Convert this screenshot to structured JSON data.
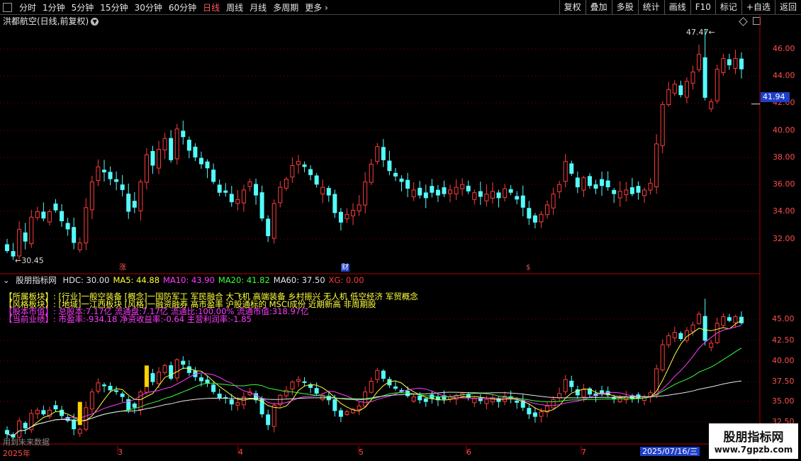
{
  "toolbar": {
    "timeframes": [
      "分时",
      "1分钟",
      "5分钟",
      "15分钟",
      "30分钟",
      "60分钟",
      "日线",
      "周线",
      "月线",
      "多周期",
      "更多"
    ],
    "active": "日线",
    "right_buttons": [
      "复权",
      "叠加",
      "多股",
      "统计",
      "画线",
      "F10",
      "标记",
      "+自选",
      "返回"
    ]
  },
  "stock": {
    "title": "洪都航空(日线,前复权)",
    "current_price": "41.94"
  },
  "price_axis": [
    "46.00",
    "44.00",
    "42.00",
    "40.00",
    "38.00",
    "36.00",
    "34.00",
    "32.00"
  ],
  "annotations": {
    "high": "47.47",
    "low": "30.45"
  },
  "events": [
    "涨",
    "财",
    "$"
  ],
  "indicator": {
    "name": "股朋指标网",
    "values": [
      {
        "label": "HDC: 30.00",
        "color": "#e6e6e6"
      },
      {
        "label": "MA5: 44.88",
        "color": "#ffff3c"
      },
      {
        "label": "MA10: 43.90",
        "color": "#ff3cff"
      },
      {
        "label": "MA20: 41.82",
        "color": "#3cff3c"
      },
      {
        "label": "MA60: 37.50",
        "color": "#e6e6e6"
      },
      {
        "label": "XG: 0.00",
        "color": "#ff3c3c"
      }
    ],
    "axis": [
      "45.00",
      "42.50",
      "40.00",
      "37.50",
      "35.00",
      "32.50"
    ]
  },
  "info_lines": [
    {
      "text": "【所属板块】: [行业]一般空装备 [概念]一国防军工 军民融合 大飞机 高端装备 乡村振兴 无人机 低空经济 军贸概念",
      "color": "#ffff3c"
    },
    {
      "text": "【风格板块】: [地域]一江西板块 [风格]一融资融券 高市盈率 沪股通标的 MSCI成份 近期新高 非周期股",
      "color": "#ffff3c"
    },
    {
      "text": "【股本市值】: 总股本:7.17亿 流通盘:7.17亿 流通比:100.00% 流通市值:318.97亿",
      "color": "#ff3cff"
    },
    {
      "text": "【当前业绩】: 市盈率:-934.18 净资收益率:-0.64 主营利润率:-1.85",
      "color": "#ff3cff"
    }
  ],
  "dates": [
    "2025年",
    "3",
    "4",
    "5",
    "6",
    "7"
  ],
  "date_tag": "2025/07/16/三",
  "footer": "用到未来数据",
  "watermark": {
    "name": "股朋指标网",
    "url": "www.7gpzb.com"
  },
  "colors": {
    "up": "#ff3c3c",
    "down": "#54fcfc",
    "background": "#000000",
    "grid": "#7a0000",
    "tag": "#1e40c8"
  },
  "chart_data": {
    "type": "candlestick",
    "title": "洪都航空(日线,前复权)",
    "ylim": [
      31,
      47.5
    ],
    "closes": [
      31.1,
      30.7,
      32.7,
      31.8,
      33.6,
      34.0,
      33.5,
      34.0,
      34.1,
      33.3,
      32.7,
      31.7,
      31.7,
      34.3,
      36.2,
      37.3,
      36.9,
      36.4,
      36.2,
      35.6,
      34.0,
      34.3,
      36.2,
      38.2,
      37.4,
      38.6,
      39.4,
      37.8,
      40.1,
      39.5,
      38.5,
      38.0,
      37.5,
      37.2,
      36.2,
      35.4,
      35.4,
      34.7,
      34.9,
      35.6,
      36.2,
      35.2,
      33.5,
      32.2,
      34.6,
      35.8,
      36.4,
      37.4,
      37.7,
      37.3,
      36.7,
      36.0,
      35.8,
      35.2,
      33.9,
      33.2,
      33.8,
      34.1,
      34.5,
      36.2,
      37.5,
      38.8,
      37.8,
      37.0,
      36.6,
      36.2,
      35.7,
      35.6,
      35.2,
      35.0,
      35.4,
      35.2,
      35.3,
      35.6,
      35.8,
      36.0,
      35.5,
      35.4,
      35.1,
      35.3,
      35.5,
      35.0,
      35.7,
      35.4,
      34.9,
      34.3,
      33.5,
      33.2,
      33.8,
      34.5,
      35.3,
      36.0,
      37.7,
      36.8,
      35.8,
      36.5,
      35.9,
      35.7,
      35.9,
      35.8,
      35.3,
      35.5,
      35.6,
      35.3,
      35.4,
      35.6,
      36.1,
      39.0,
      41.9,
      43.0,
      43.4,
      42.6,
      43.6,
      44.3,
      45.6,
      42.4,
      42.1,
      44.5,
      45.3,
      44.8,
      45.3,
      44.5
    ],
    "high": 47.47,
    "low": 30.45
  }
}
